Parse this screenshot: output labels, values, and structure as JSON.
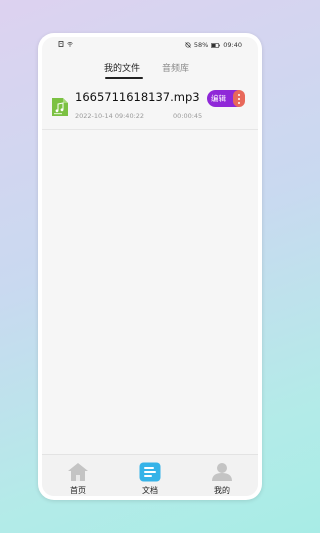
{
  "status_bar": {
    "battery": "58%",
    "time": "09:40",
    "left_icons": [
      "document-icon",
      "wifi-icon"
    ]
  },
  "tabs": [
    {
      "label": "我的文件",
      "active": true
    },
    {
      "label": "音频库",
      "active": false
    }
  ],
  "files": [
    {
      "name": "1665711618137.mp3",
      "date": "2022-10-14 09:40:22",
      "duration": "00:00:45",
      "edit_label": "编辑",
      "icon": "music-file-icon"
    }
  ],
  "bottom_nav": [
    {
      "label": "首页",
      "icon": "home-icon",
      "active": false
    },
    {
      "label": "文档",
      "icon": "document-list-icon",
      "active": true
    },
    {
      "label": "我的",
      "icon": "user-icon",
      "active": false
    }
  ],
  "colors": {
    "edit_button": "#8f28d8",
    "more_button": "#e8685a",
    "file_icon": "#7bc142",
    "nav_active": "#36b3e8",
    "nav_inactive": "#c4c4c4"
  }
}
